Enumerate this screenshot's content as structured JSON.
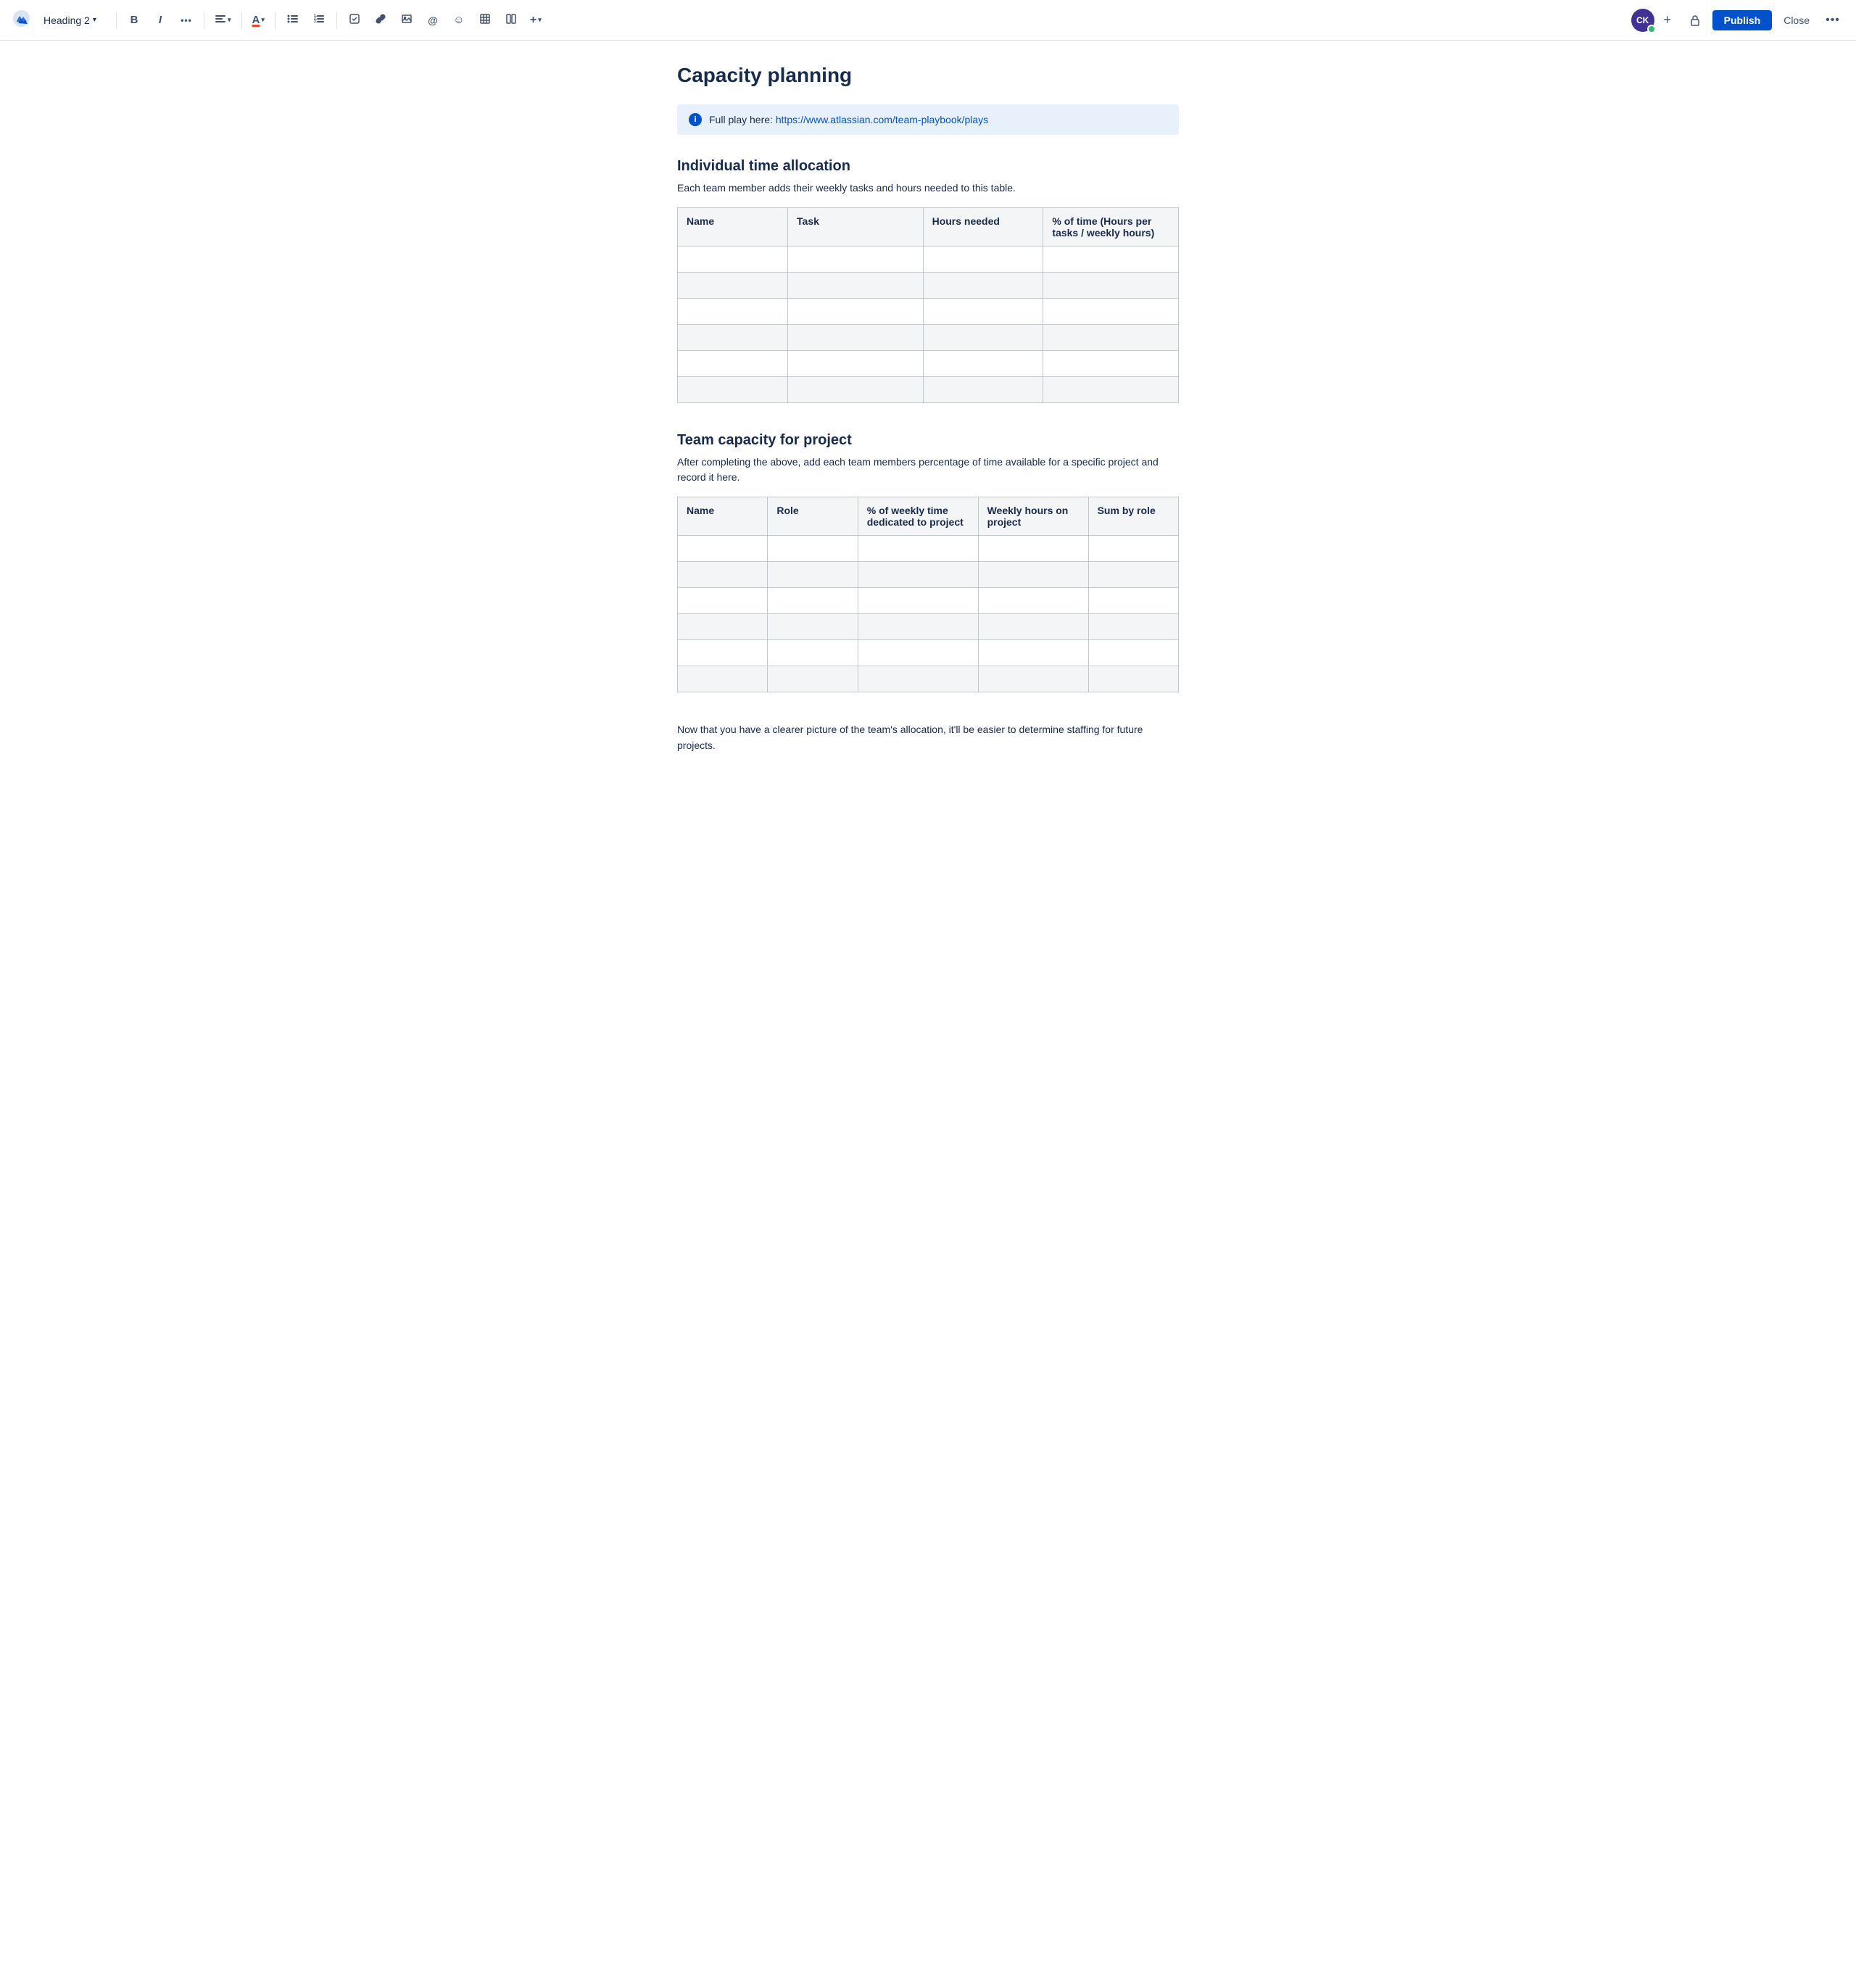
{
  "toolbar": {
    "heading_select": "Heading 2",
    "chevron": "▾",
    "bold": "B",
    "italic": "I",
    "more_format": "•••",
    "align": "≡",
    "color": "A",
    "bullet_list": "☰",
    "numbered_list": "☰",
    "task": "☑",
    "link": "🔗",
    "image": "🖼",
    "mention": "@",
    "emoji": "☺",
    "table": "⊞",
    "layout": "⊟",
    "plus_more": "+",
    "avatar_text": "CK",
    "add_plus": "+",
    "lock_icon": "🔒",
    "publish_label": "Publish",
    "close_label": "Close",
    "more_options": "•••"
  },
  "page": {
    "title": "Capacity planning"
  },
  "info_box": {
    "text": "Full play here: ",
    "link_text": "https://www.atlassian.com/team-playbook/plays",
    "link_href": "https://www.atlassian.com/team-playbook/plays"
  },
  "section1": {
    "title": "Individual time allocation",
    "description": "Each team member adds their weekly tasks and hours needed to this table.",
    "table": {
      "headers": [
        "Name",
        "Task",
        "Hours needed",
        "% of time (Hours per tasks / weekly hours)"
      ],
      "rows": [
        [
          "",
          "",
          "",
          ""
        ],
        [
          "",
          "",
          "",
          ""
        ],
        [
          "",
          "",
          "",
          ""
        ],
        [
          "",
          "",
          "",
          ""
        ],
        [
          "",
          "",
          "",
          ""
        ],
        [
          "",
          "",
          "",
          ""
        ]
      ]
    }
  },
  "section2": {
    "title": "Team capacity for project",
    "description": "After completing the above, add each team members percentage of time available for a specific project and record it here.",
    "table": {
      "headers": [
        "Name",
        "Role",
        "% of weekly time dedicated to project",
        "Weekly hours on project",
        "Sum by role"
      ],
      "rows": [
        [
          "",
          "",
          "",
          "",
          ""
        ],
        [
          "",
          "",
          "",
          "",
          ""
        ],
        [
          "",
          "",
          "",
          "",
          ""
        ],
        [
          "",
          "",
          "",
          "",
          ""
        ],
        [
          "",
          "",
          "",
          "",
          ""
        ],
        [
          "",
          "",
          "",
          "",
          ""
        ]
      ]
    }
  },
  "footer": {
    "text": "Now that you have a clearer picture of the team's allocation, it'll be easier to determine staffing for future projects."
  }
}
